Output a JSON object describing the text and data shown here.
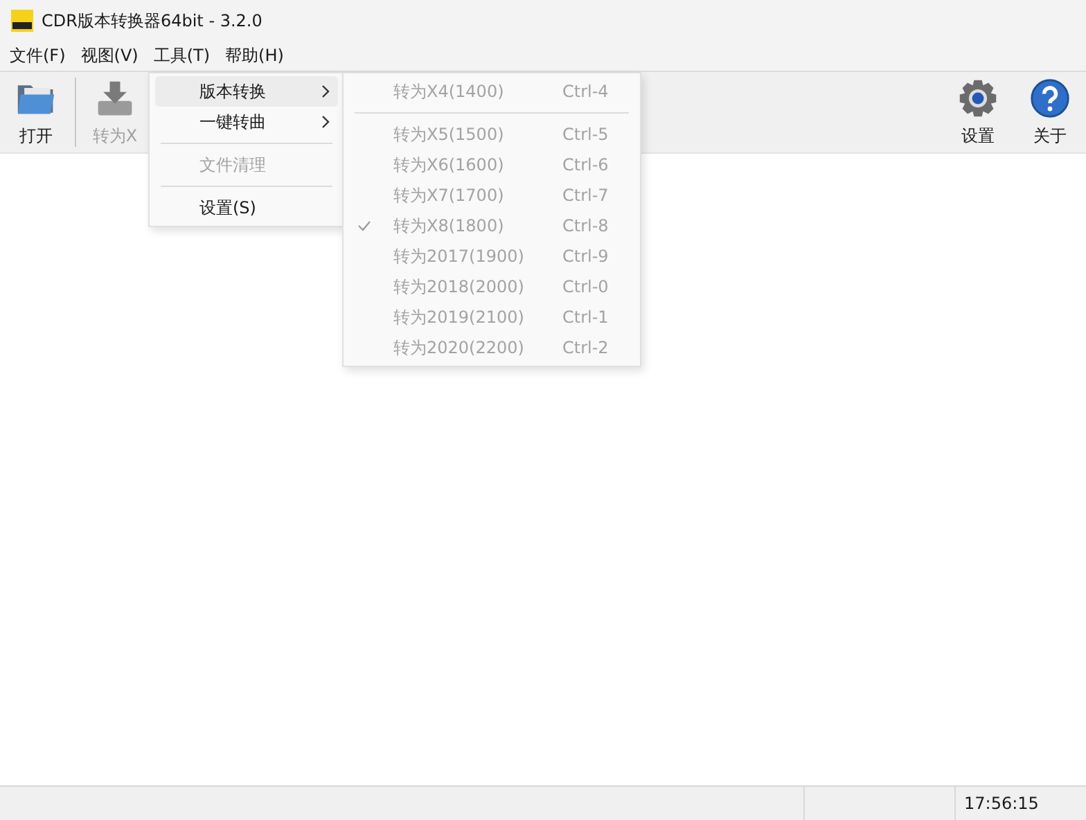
{
  "window": {
    "title": "CDR版本转换器64bit - 3.2.0"
  },
  "menubar": [
    {
      "label": "文件(F)"
    },
    {
      "label": "视图(V)"
    },
    {
      "label": "工具(T)"
    },
    {
      "label": "帮助(H)"
    }
  ],
  "toolbar_left": [
    {
      "label": "打开",
      "kind": "folder",
      "disabled": false
    },
    {
      "label": "转为X",
      "kind": "drive",
      "disabled": true
    }
  ],
  "toolbar_right": [
    {
      "label": "设置",
      "kind": "gear",
      "disabled": false
    },
    {
      "label": "关于",
      "kind": "help",
      "disabled": false
    }
  ],
  "tools_menu": [
    {
      "kind": "item",
      "label": "版本转换",
      "submenu": true,
      "selected": true,
      "disabled": false
    },
    {
      "kind": "item",
      "label": "一键转曲",
      "submenu": true,
      "selected": false,
      "disabled": false
    },
    {
      "kind": "separator"
    },
    {
      "kind": "item",
      "label": "文件清理",
      "submenu": false,
      "selected": false,
      "disabled": true
    },
    {
      "kind": "separator"
    },
    {
      "kind": "item",
      "label": "设置(S)",
      "submenu": false,
      "selected": false,
      "disabled": false
    }
  ],
  "submenu": [
    {
      "kind": "item",
      "label": "转为X4(1400)",
      "shortcut": "Ctrl-4",
      "checked": false,
      "disabled": true
    },
    {
      "kind": "separator"
    },
    {
      "kind": "item",
      "label": "转为X5(1500)",
      "shortcut": "Ctrl-5",
      "checked": false,
      "disabled": true
    },
    {
      "kind": "item",
      "label": "转为X6(1600)",
      "shortcut": "Ctrl-6",
      "checked": false,
      "disabled": true
    },
    {
      "kind": "item",
      "label": "转为X7(1700)",
      "shortcut": "Ctrl-7",
      "checked": false,
      "disabled": true
    },
    {
      "kind": "item",
      "label": "转为X8(1800)",
      "shortcut": "Ctrl-8",
      "checked": true,
      "disabled": true
    },
    {
      "kind": "item",
      "label": "转为2017(1900)",
      "shortcut": "Ctrl-9",
      "checked": false,
      "disabled": true
    },
    {
      "kind": "item",
      "label": "转为2018(2000)",
      "shortcut": "Ctrl-0",
      "checked": false,
      "disabled": true
    },
    {
      "kind": "item",
      "label": "转为2019(2100)",
      "shortcut": "Ctrl-1",
      "checked": false,
      "disabled": true
    },
    {
      "kind": "item",
      "label": "转为2020(2200)",
      "shortcut": "Ctrl-2",
      "checked": false,
      "disabled": true
    }
  ],
  "status_bar": {
    "time": "17:56:15"
  }
}
